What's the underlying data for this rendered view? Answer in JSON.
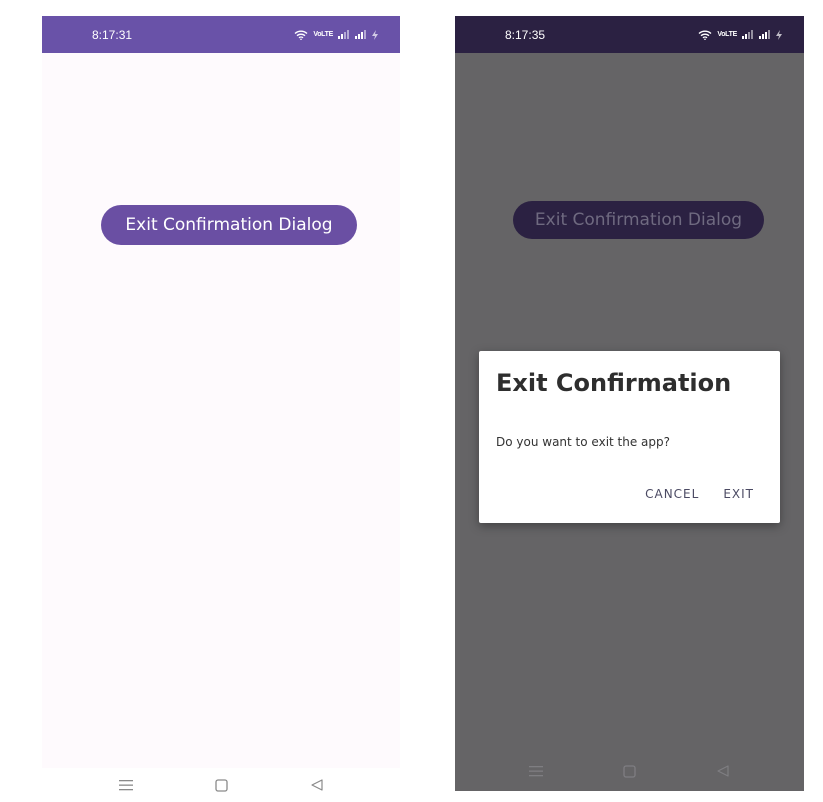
{
  "left_screen": {
    "status_bar": {
      "time": "8:17:31",
      "network_label": "VoLTE"
    },
    "main_button_label": "Exit Confirmation Dialog"
  },
  "right_screen": {
    "status_bar": {
      "time": "8:17:35",
      "network_label": "VoLTE"
    },
    "main_button_label": "Exit Confirmation Dialog",
    "dialog": {
      "title": "Exit Confirmation",
      "message": "Do you want to exit the app?",
      "cancel_label": "CANCEL",
      "exit_label": "EXIT"
    }
  },
  "icons": {
    "status": [
      "wifi-icon",
      "signal-icon",
      "signal-icon",
      "charging-icon"
    ],
    "nav": [
      "menu-icon",
      "home-icon",
      "back-icon"
    ]
  },
  "colors": {
    "primary": "#6a4fa3",
    "status_bar_light": "#6952a8",
    "status_bar_dimmed": "#2b2142",
    "scrim": "#656466",
    "background": "#fefafd",
    "dialog_action": "#4b4a63"
  }
}
